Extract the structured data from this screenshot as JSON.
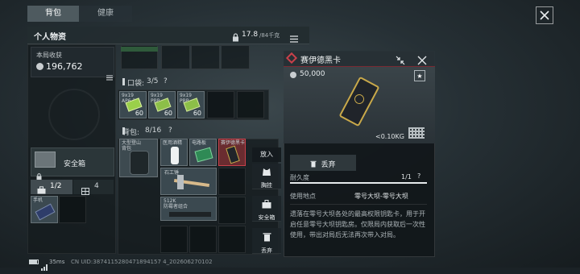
{
  "tabs": [
    "背包",
    "健康"
  ],
  "personal": {
    "title": "个人物资",
    "weight": "17.8",
    "weight_cap": "/84千克"
  },
  "earnings": {
    "label": "本局收获",
    "value": "196,762"
  },
  "pocket": {
    "label": "口袋:",
    "count": "3/5",
    "help": "?",
    "items": [
      {
        "name": "9x19\nAP6.3",
        "qty": "60"
      },
      {
        "name": "9x19\nPBP",
        "qty": "60"
      },
      {
        "name": "9x19\nPBP",
        "qty": "60"
      }
    ]
  },
  "backpack": {
    "label": "背包:",
    "count": "8/16",
    "help": "?",
    "items": [
      {
        "name": "大型登山\n背包"
      },
      {
        "name": "医用酒精"
      },
      {
        "name": "电路板"
      },
      {
        "name": "赛伊德黑卡"
      },
      {
        "name": "石工锤"
      },
      {
        "name": "512K\n防霉者组合"
      }
    ]
  },
  "safe_box": {
    "label": "安全箱"
  },
  "storage": {
    "tab1": "1/2",
    "tab2": "4",
    "item_label": "手机"
  },
  "context_menu": {
    "place": "放入",
    "chest": "胸挂",
    "safe": "安全箱",
    "discard": "丢弃"
  },
  "detail": {
    "title": "赛伊德黑卡",
    "price": "50,000",
    "weight": "<0.10KG",
    "discard": "丢弃",
    "durability_label": "耐久度",
    "durability_value": "1/1",
    "durability_fraction": 1.0,
    "help": "?",
    "use_label": "使用地点",
    "use_value": "零号大坝-零号大坝",
    "description": "遗落在零号大坝各处的最高权限钥匙卡，用于开启任意零号大坝钥匙房。仅限局内获取后一次性使用，带出对局后无法再次带入对局。"
  },
  "status": {
    "ping": "35ms",
    "uid": "CN UID:3874115280471894157 4_202606270102"
  },
  "colors": {
    "accent": "#c8404a",
    "green": "#44a86a",
    "gold": "#c9a94a"
  }
}
